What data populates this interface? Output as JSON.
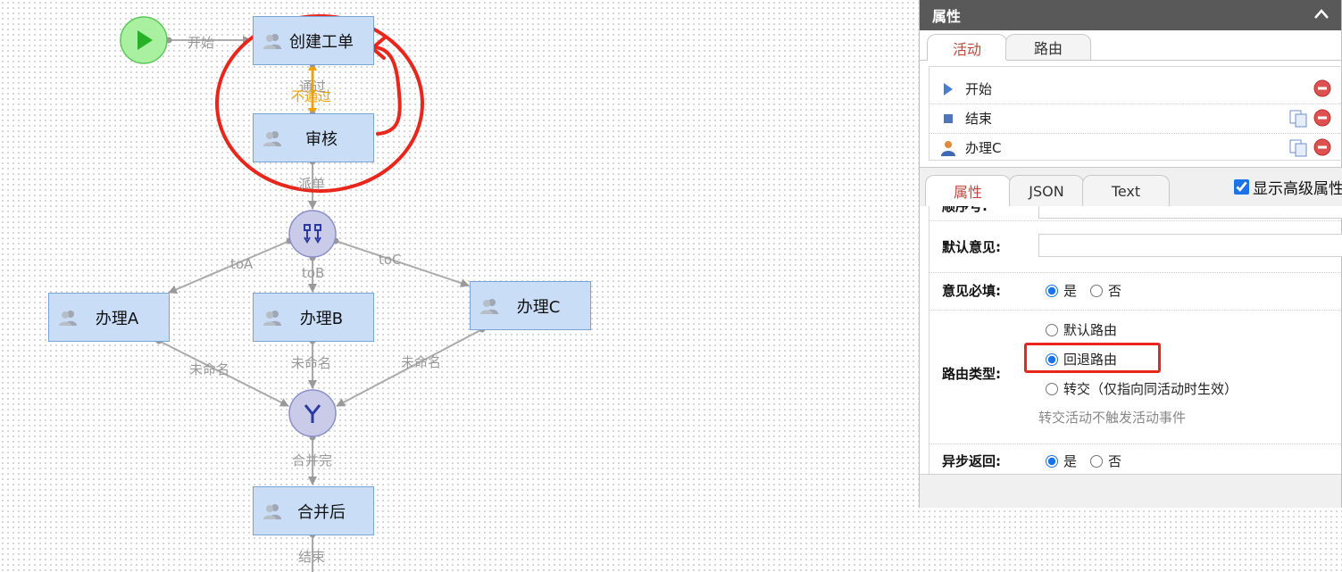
{
  "flow": {
    "nodes": {
      "create": "创建工单",
      "review": "审核",
      "handle_a": "办理A",
      "handle_b": "办理B",
      "handle_c": "办理C",
      "after_merge": "合并后"
    },
    "edges": {
      "start": "开始",
      "pass": "通过",
      "fail": "不通过",
      "dispatch": "派单",
      "to_a": "toA",
      "to_b": "toB",
      "to_c": "toC",
      "unnamed_a": "未命名",
      "unnamed_b": "未命名",
      "unnamed_c": "未命名",
      "merge_done": "合并完",
      "end": "结束"
    },
    "annotation_color": "#e8261c"
  },
  "panel": {
    "title": "属性",
    "tabs": [
      "活动",
      "路由"
    ],
    "activities": [
      {
        "name": "开始",
        "icon": "start-triangle-icon"
      },
      {
        "name": "结束",
        "icon": "end-square-icon"
      },
      {
        "name": "办理C",
        "icon": "user-icon"
      }
    ],
    "prop_tabs": [
      "属性",
      "JSON",
      "Text"
    ],
    "advanced_label": "显示高级属性",
    "form": {
      "order_label": "顺序号:",
      "default_opinion_label": "默认意见:",
      "opinion_required_label": "意见必填:",
      "yes": "是",
      "no": "否",
      "route_type_label": "路由类型:",
      "route_default": "默认路由",
      "route_back": "回退路由",
      "route_transfer": "转交（仅指向同活动时生效）",
      "transfer_hint": "转交活动不触发活动事件",
      "async_return_label": "异步返回:"
    }
  }
}
